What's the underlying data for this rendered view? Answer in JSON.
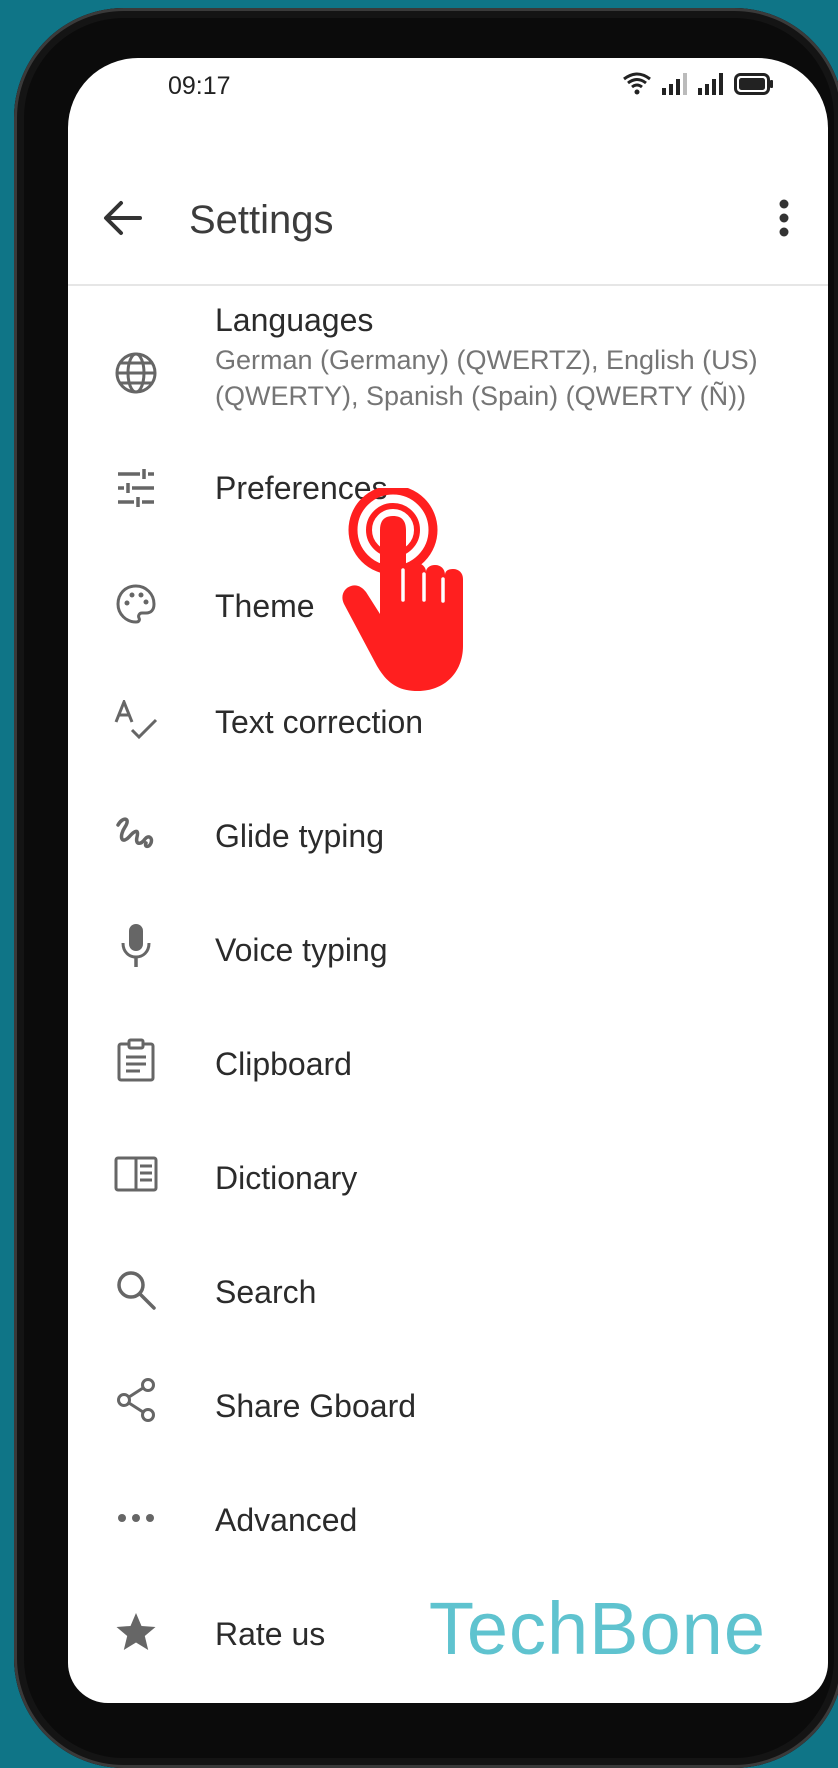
{
  "status_bar": {
    "time": "09:17",
    "icons": [
      "wifi-icon",
      "signal-icon",
      "signal-icon",
      "battery-icon"
    ]
  },
  "app_bar": {
    "title": "Settings",
    "back_icon": "arrow-back-icon",
    "menu_icon": "more-vert-icon"
  },
  "settings": {
    "items": [
      {
        "label": "Languages",
        "summary": "German (Germany) (QWERTZ), English (US) (QWERTY), Spanish (Spain) (QWERTY (Ñ))",
        "icon": "globe-icon"
      },
      {
        "label": "Preferences",
        "icon": "tune-icon"
      },
      {
        "label": "Theme",
        "icon": "palette-icon"
      },
      {
        "label": "Text correction",
        "icon": "spellcheck-icon"
      },
      {
        "label": "Glide typing",
        "icon": "gesture-icon"
      },
      {
        "label": "Voice typing",
        "icon": "mic-icon"
      },
      {
        "label": "Clipboard",
        "icon": "clipboard-icon"
      },
      {
        "label": "Dictionary",
        "icon": "book-icon"
      },
      {
        "label": "Search",
        "icon": "search-icon"
      },
      {
        "label": "Share Gboard",
        "icon": "share-icon"
      },
      {
        "label": "Advanced",
        "icon": "more-horiz-icon"
      },
      {
        "label": "Rate us",
        "icon": "star-icon"
      }
    ]
  },
  "overlay": {
    "tap_indicator_icon": "pointing-hand-icon",
    "tap_color": "#ff1f1f"
  },
  "watermark": {
    "text": "TechBone",
    "color": "#5fc3cf"
  }
}
